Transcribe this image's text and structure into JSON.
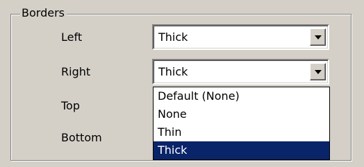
{
  "group": {
    "title": "Borders"
  },
  "rows": [
    {
      "label": "Left",
      "value": "Thick"
    },
    {
      "label": "Right",
      "value": "Thick"
    },
    {
      "label": "Top"
    },
    {
      "label": "Bottom"
    }
  ],
  "dropdown": {
    "options": [
      "Default (None)",
      "None",
      "Thin",
      "Thick"
    ],
    "highlighted": "Thick"
  },
  "colors": {
    "face": "#d4d0c8",
    "highlight": "#0a246a",
    "highlight_text": "#ffffff"
  },
  "icons": {
    "combo_button": "chevron-down-icon"
  }
}
